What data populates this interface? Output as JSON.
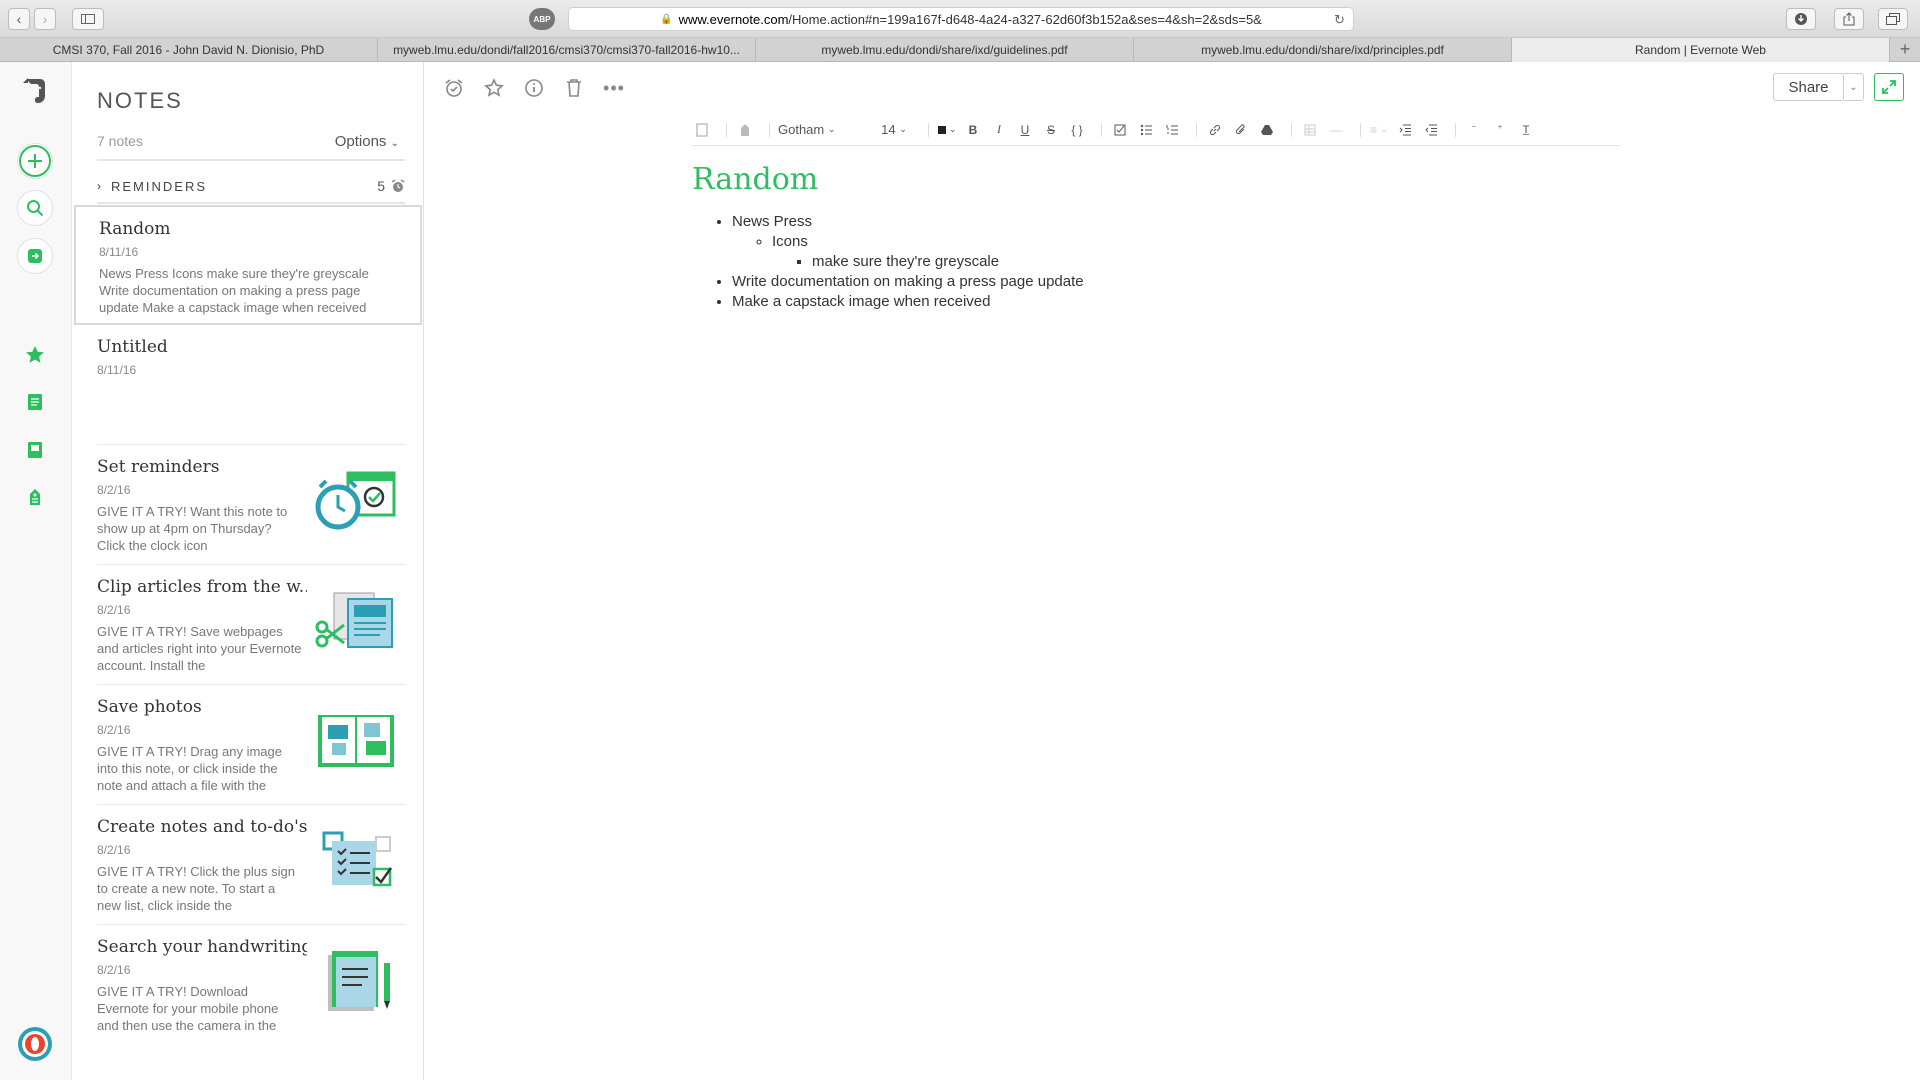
{
  "browser": {
    "url_domain": "www.evernote.com",
    "url_path": "/Home.action#n=199a167f-d648-4a24-a327-62d60f3b152a&ses=4&sh=2&sds=5&",
    "abp_label": "ABP",
    "tabs": [
      {
        "label": "CMSI 370, Fall 2016 - John David N. Dionisio, PhD"
      },
      {
        "label": "myweb.lmu.edu/dondi/fall2016/cmsi370/cmsi370-fall2016-hw10..."
      },
      {
        "label": "myweb.lmu.edu/dondi/share/ixd/guidelines.pdf"
      },
      {
        "label": "myweb.lmu.edu/dondi/share/ixd/principles.pdf"
      },
      {
        "label": "Random | Evernote Web"
      }
    ]
  },
  "notes_panel": {
    "title": "NOTES",
    "count": "7 notes",
    "options_label": "Options",
    "reminders_label": "REMINDERS",
    "reminders_count": "5",
    "notes": [
      {
        "title": "Random",
        "date": "8/11/16",
        "snippet": "News Press Icons make sure they're greyscale Write documentation on making a press page update Make a capstack image when received"
      },
      {
        "title": "Untitled",
        "date": "8/11/16",
        "snippet": ""
      },
      {
        "title": "Set reminders",
        "date": "8/2/16",
        "snippet": "GIVE IT A TRY! Want this note to show up at 4pm on Thursday? Click the clock icon"
      },
      {
        "title": "Clip articles from the w...",
        "date": "8/2/16",
        "snippet": "GIVE IT A TRY! Save webpages and articles right into your Evernote account. Install the"
      },
      {
        "title": "Save photos",
        "date": "8/2/16",
        "snippet": "GIVE IT A TRY! Drag any image into this note, or click inside the note and attach a file with the"
      },
      {
        "title": "Create notes and to-do's",
        "date": "8/2/16",
        "snippet": "GIVE IT A TRY! Click the plus sign to create a new note. To start a new list, click inside the"
      },
      {
        "title": "Search your handwriting",
        "date": "8/2/16",
        "snippet": "GIVE IT A TRY! Download Evernote for your mobile phone and then use the camera in the"
      }
    ]
  },
  "editor": {
    "share_label": "Share",
    "font_name": "Gotham",
    "font_size": "14",
    "note_title": "Random",
    "items": {
      "l1_a": "News Press",
      "l2_a": "Icons",
      "l3_a": "make sure they're greyscale",
      "l1_b": "Write documentation on making a press page update",
      "l1_c": "Make a capstack image when received"
    }
  },
  "colors": {
    "accent_green": "#2dbe60",
    "thumb_blue": "#2c9fb5"
  }
}
